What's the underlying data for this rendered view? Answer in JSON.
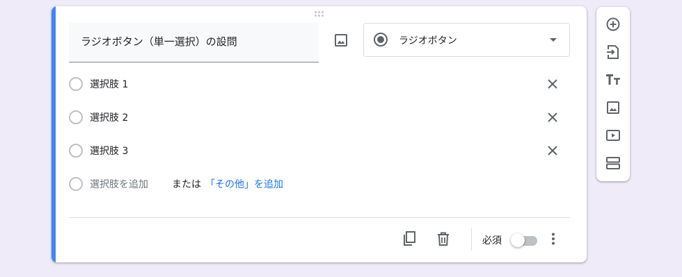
{
  "question": {
    "title": "ラジオボタン（単一選択）の設問",
    "type_label": "ラジオボタン",
    "options": [
      {
        "label": "選択肢 1"
      },
      {
        "label": "選択肢 2"
      },
      {
        "label": "選択肢 3"
      }
    ],
    "add_option_label": "選択肢を追加",
    "or_label": "または",
    "add_other_label": "「その他」を追加"
  },
  "footer": {
    "required_label": "必須",
    "required_on": false
  },
  "side_toolbar": {
    "items": [
      "add-question-icon",
      "import-questions-icon",
      "add-title-icon",
      "add-image-icon",
      "add-video-icon",
      "add-section-icon"
    ]
  },
  "colors": {
    "accent": "#4285f4",
    "link": "#1a73e8",
    "background": "#f0ebf8"
  }
}
